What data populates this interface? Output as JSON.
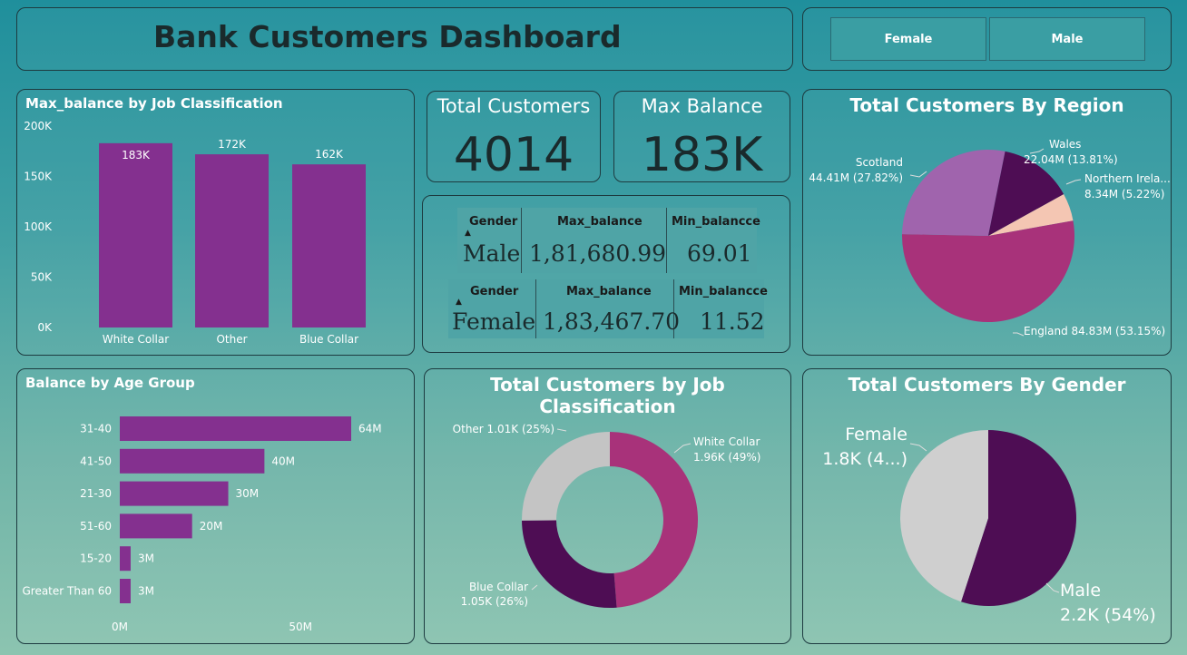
{
  "title": "Bank Customers Dashboard",
  "slicer": {
    "female": "Female",
    "male": "Male"
  },
  "cards": {
    "total_customers": {
      "label": "Total Customers",
      "value": "4014"
    },
    "max_balance": {
      "label": "Max Balance",
      "value": "183K"
    }
  },
  "gender_table": {
    "male": {
      "h_gender": "Gender",
      "h_max": "Max_balance",
      "h_min": "Min_balancce",
      "gender": "Male",
      "max": "1,81,680.99",
      "min": "69.01"
    },
    "female": {
      "h_gender": "Gender",
      "h_max": "Max_balance",
      "h_min": "Min_balancce",
      "gender": "Female",
      "max": "1,83,467.70",
      "min": "11.52"
    }
  },
  "colors": {
    "purple": "#84308f",
    "dark_purple": "#4e0d54",
    "magenta": "#a8327a",
    "lavender": "#a064ad",
    "peach": "#f4c6b3",
    "grey": "#c4c4c4"
  },
  "chart_data": [
    {
      "type": "bar",
      "title": "Max_balance by Job Classification",
      "categories": [
        "White Collar",
        "Other",
        "Blue Collar"
      ],
      "values": [
        183000,
        172000,
        162000
      ],
      "data_labels": [
        "183K",
        "172K",
        "162K"
      ],
      "y_ticks": [
        "200K",
        "150K",
        "100K",
        "50K",
        "0K"
      ],
      "ylim": [
        0,
        200000
      ]
    },
    {
      "type": "pie",
      "title": "Total Customers By Region",
      "slices": [
        {
          "name": "England",
          "value": 84.83,
          "label": "England 84.83M (53.15%)"
        },
        {
          "name": "Scotland",
          "value": 44.41,
          "label_name": "Scotland",
          "label": "44.41M (27.82%)"
        },
        {
          "name": "Wales",
          "value": 22.04,
          "label_name": "Wales",
          "label": "22.04M (13.81%)"
        },
        {
          "name": "Northern Ireland",
          "value": 8.34,
          "label_name": "Northern Irela...",
          "label": "8.34M (5.22%)"
        }
      ]
    },
    {
      "type": "bar",
      "orientation": "horizontal",
      "title": "Balance by Age Group",
      "categories": [
        "31-40",
        "41-50",
        "21-30",
        "51-60",
        "15-20",
        "Greater Than 60"
      ],
      "values": [
        64,
        40,
        30,
        20,
        3,
        3
      ],
      "data_labels": [
        "64M",
        "40M",
        "30M",
        "20M",
        "3M",
        "3M"
      ],
      "x_ticks": [
        "0M",
        "50M"
      ],
      "xlim": [
        0,
        64
      ]
    },
    {
      "type": "pie",
      "donut": true,
      "title": "Total Customers by Job Classification",
      "slices": [
        {
          "name": "White Collar",
          "value": 1.96,
          "label": "White Collar",
          "sublabel": "1.96K (49%)"
        },
        {
          "name": "Blue Collar",
          "value": 1.05,
          "label": "Blue Collar",
          "sublabel": "1.05K (26%)"
        },
        {
          "name": "Other",
          "value": 1.01,
          "label": "Other 1.01K (25%)"
        }
      ]
    },
    {
      "type": "pie",
      "title": "Total Customers By Gender",
      "slices": [
        {
          "name": "Male",
          "value": 2.2,
          "label": "Male",
          "sublabel": "2.2K (54%)"
        },
        {
          "name": "Female",
          "value": 1.8,
          "label": "Female",
          "sublabel": "1.8K (4...)"
        }
      ]
    }
  ]
}
